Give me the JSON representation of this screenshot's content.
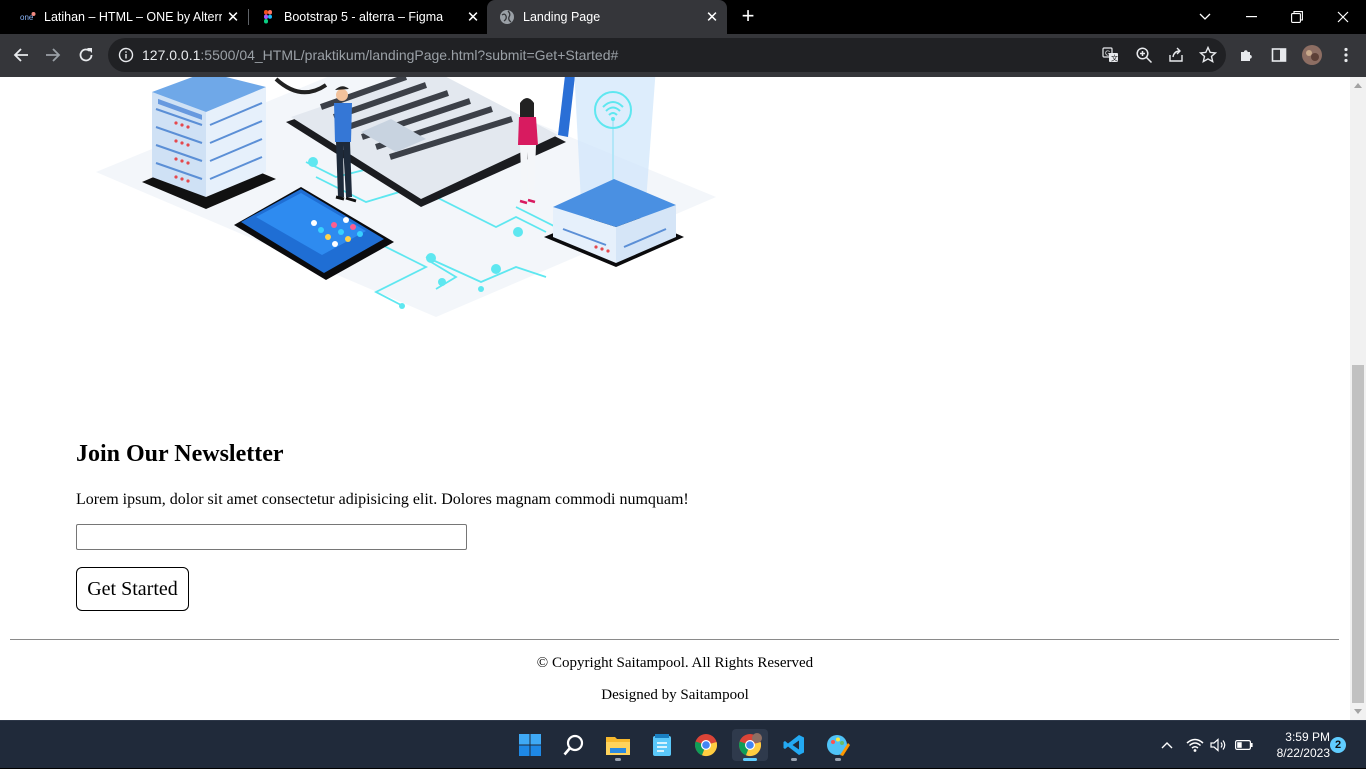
{
  "browser": {
    "tabs": [
      {
        "title": "Latihan – HTML – ONE by Alterra",
        "icon": "alterra-one-icon",
        "active": false
      },
      {
        "title": "Bootstrap 5 - alterra – Figma",
        "icon": "figma-icon",
        "active": false
      },
      {
        "title": "Landing Page",
        "icon": "globe-icon",
        "active": true
      }
    ],
    "address": {
      "host": "127.0.0.1",
      "rest": ":5500/04_HTML/praktikum/landingPage.html?submit=Get+Started#"
    },
    "icons": [
      "back-icon",
      "forward-icon",
      "reload-icon",
      "site-info-icon",
      "translate-icon",
      "zoom-icon",
      "share-icon",
      "bookmark-star-icon",
      "extensions-icon",
      "side-panel-icon",
      "profile-avatar",
      "more-menu-icon"
    ]
  },
  "page": {
    "newsletter": {
      "title": "Join Our Newsletter",
      "text": "Lorem ipsum, dolor sit amet consectetur adipisicing elit. Dolores magnam commodi numquam!",
      "input_value": "",
      "button_label": "Get Started"
    },
    "footer": {
      "copyright": "© Copyright Saitampool. All Rights Reserved",
      "designed_by": "Designed by Saitampool"
    }
  },
  "taskbar": {
    "apps": [
      "windows-start-icon",
      "search-icon",
      "file-explorer-icon",
      "notepad-icon",
      "chrome-icon",
      "chrome-profile-icon",
      "vscode-icon",
      "paint-icon"
    ],
    "clock": {
      "time": "3:59 PM",
      "date": "8/22/2023"
    },
    "notification_count": "2"
  },
  "colors": {
    "tab_active": "#35363a",
    "omnibox": "#202124",
    "taskbar": "#202a3a",
    "accent": "#60cdff"
  }
}
